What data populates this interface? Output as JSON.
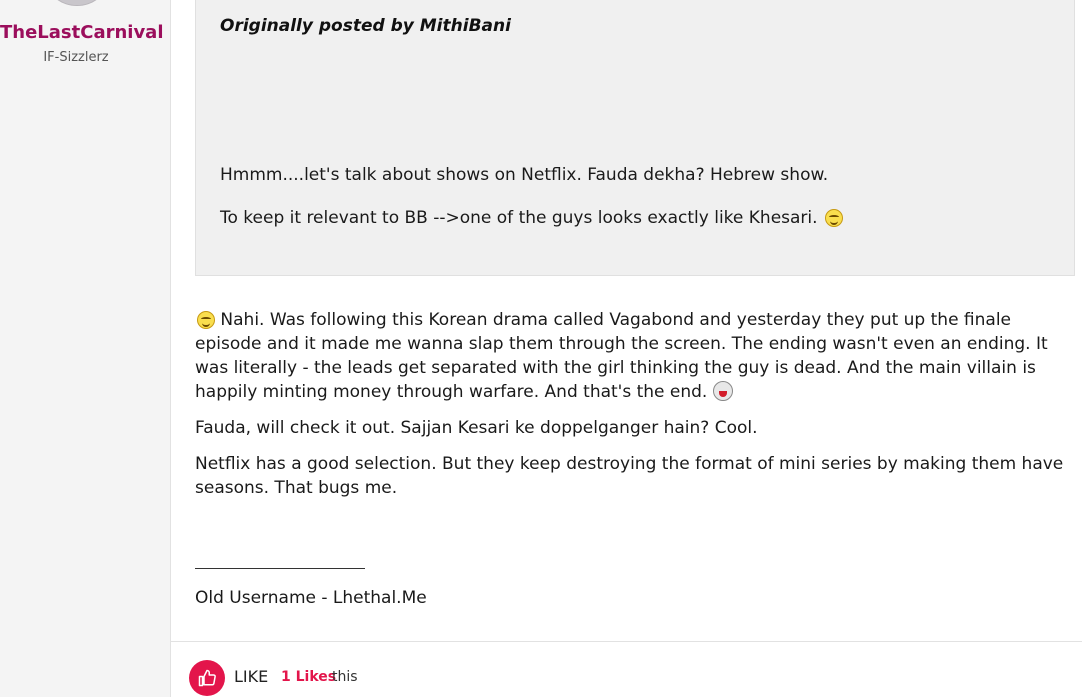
{
  "author": {
    "username": "TheLastCarnival",
    "rank": "IF-Sizzlerz"
  },
  "quote": {
    "header": "Originally posted by MithiBani",
    "lines": [
      "Hmmm....let's talk about shows on Netflix. Fauda dekha? Hebrew show.",
      "To keep it relevant to BB -->one of the guys looks exactly like Khesari."
    ],
    "emoji": "smiley-icon"
  },
  "post": {
    "paragraphs": [
      "Nahi. Was following this Korean drama called Vagabond and yesterday they put up the finale episode and it made me wanna slap them through the screen. The ending wasn't even an ending. It was literally - the leads get separated with the girl thinking the guy is dead. And the main villain is happily minting money through warfare. And that's the end.",
      "Fauda, will check it out. Sajjan Kesari ke doppelganger hain? Cool.",
      "Netflix has a good selection. But they keep destroying the format of mini series by making them have seasons. That bugs me."
    ],
    "lead_emoji": "smiley-icon",
    "trail_emoji": "laugh-icon"
  },
  "signature": {
    "text": "Old Username - Lhethal.Me"
  },
  "footer": {
    "like_label": "LIKE",
    "likes_count": "1 Likes",
    "likes_suffix": "this",
    "accent_color": "#e3154b"
  }
}
